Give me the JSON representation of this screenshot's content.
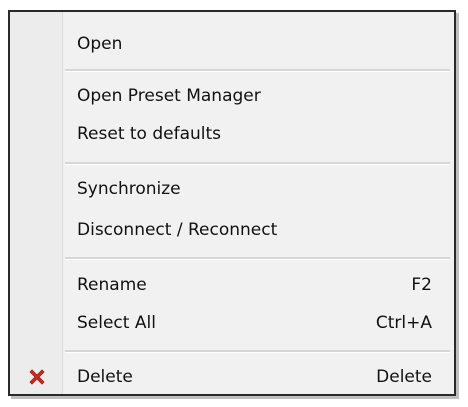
{
  "menu": {
    "items": [
      {
        "label": "Open",
        "shortcut": ""
      },
      {
        "label": "Open Preset Manager",
        "shortcut": ""
      },
      {
        "label": "Reset to defaults",
        "shortcut": ""
      },
      {
        "label": "Synchronize",
        "shortcut": ""
      },
      {
        "label": "Disconnect / Reconnect",
        "shortcut": ""
      },
      {
        "label": "Rename",
        "shortcut": "F2"
      },
      {
        "label": "Select All",
        "shortcut": "Ctrl+A"
      },
      {
        "label": "Delete",
        "shortcut": "Delete",
        "icon": "red-x-icon"
      }
    ]
  },
  "colors": {
    "delete_icon": "#d42a1e",
    "menu_background": "#f1f1f1",
    "separator": "#d6d6d6"
  }
}
